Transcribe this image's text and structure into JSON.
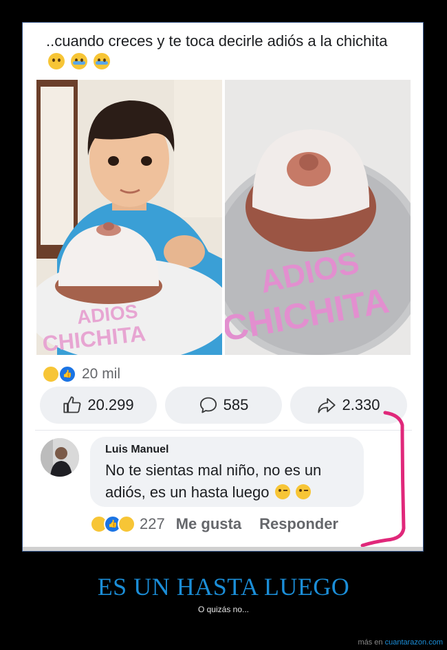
{
  "post": {
    "text": "..cuando creces y te toca decirle adiós a la chichita",
    "emojis": [
      "pleading-face",
      "loudly-crying-face",
      "loudly-crying-face"
    ]
  },
  "photos": {
    "left": {
      "cake_text_line1": "ADIOS",
      "cake_text_line2": "CHICHITA"
    },
    "right": {
      "cake_text_line1": "ADIOS",
      "cake_text_line2": "CHICHITA"
    }
  },
  "reactions": {
    "icons": [
      "haha-reaction-icon",
      "like-reaction-icon"
    ],
    "count": "20 mil"
  },
  "actions": {
    "like_count": "20.299",
    "comment_count": "585",
    "share_count": "2.330"
  },
  "comment": {
    "author": "Luis Manuel",
    "text": "No te sientas mal niño, no es un adiós, es un hasta luego",
    "reactions": [
      "haha-reaction-icon",
      "like-reaction-icon",
      "wow-reaction-icon"
    ],
    "reaction_count": "227",
    "like_label": "Me gusta",
    "reply_label": "Responder"
  },
  "caption": {
    "headline": "ES UN HASTA LUEGO",
    "subline": "O quizás no..."
  },
  "credit": {
    "prefix": "más en",
    "site": "cuantarazon.com"
  },
  "colors": {
    "headline": "#1b8ed8",
    "annotation_stroke": "#e0287a",
    "facebook_blue": "#1b74e4"
  }
}
